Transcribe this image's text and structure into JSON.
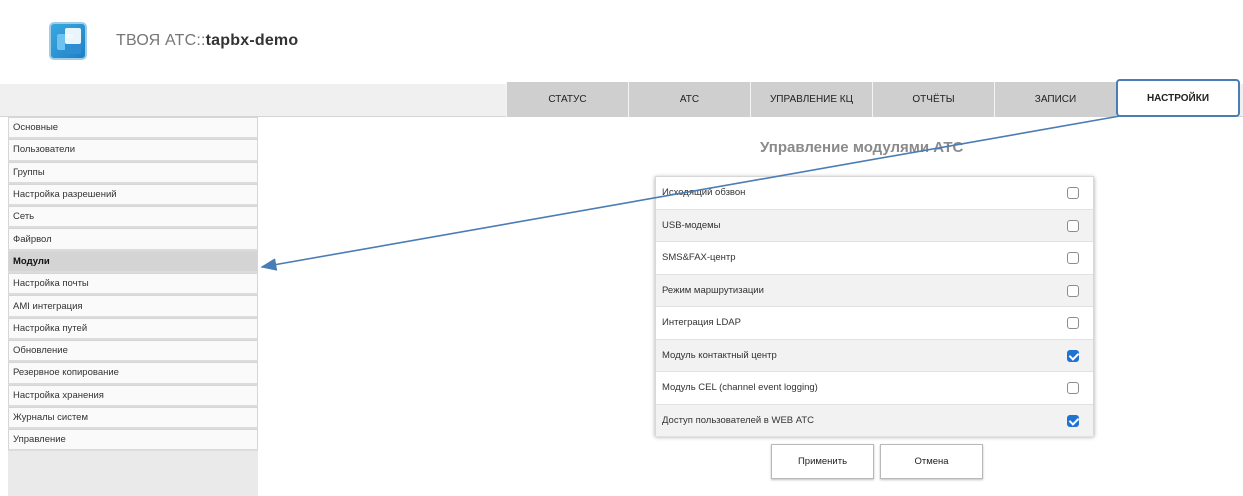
{
  "header": {
    "title_prefix": "ТВОЯ АТС::",
    "title_host": "tapbx-demo",
    "logo_icon": "app-logo-icon"
  },
  "tabs": [
    {
      "label": "СТАТУС"
    },
    {
      "label": "АТС"
    },
    {
      "label": "УПРАВЛЕНИЕ КЦ"
    },
    {
      "label": "ОТЧЁТЫ"
    },
    {
      "label": "ЗАПИСИ"
    },
    {
      "label": "НАСТРОЙКИ",
      "active": true
    }
  ],
  "sidebar": {
    "items": [
      {
        "label": "Основные"
      },
      {
        "label": "Пользователи"
      },
      {
        "label": "Группы"
      },
      {
        "label": "Настройка разрешений"
      },
      {
        "label": "Сеть"
      },
      {
        "label": "Файрвол"
      },
      {
        "label": "Модули",
        "active": true
      },
      {
        "label": "Настройка почты"
      },
      {
        "label": "AMI интеграция"
      },
      {
        "label": "Настройка путей"
      },
      {
        "label": "Обновление"
      },
      {
        "label": "Резервное копирование"
      },
      {
        "label": "Настройка хранения"
      },
      {
        "label": "Журналы систем"
      },
      {
        "label": "Управление"
      }
    ]
  },
  "main": {
    "title": "Управление модулями АТС",
    "modules": [
      {
        "label": "Исходящий обзвон",
        "checked": false
      },
      {
        "label": "USB-модемы",
        "checked": false
      },
      {
        "label": "SMS&FAX-центр",
        "checked": false
      },
      {
        "label": "Режим маршрутизации",
        "checked": false
      },
      {
        "label": "Интеграция LDAP",
        "checked": false
      },
      {
        "label": "Модуль контактный центр",
        "checked": true
      },
      {
        "label": "Модуль CEL (channel event logging)",
        "checked": false
      },
      {
        "label": "Доступ пользователей в WEB АТС",
        "checked": true
      }
    ],
    "apply_label": "Применить",
    "cancel_label": "Отмена"
  },
  "colors": {
    "accent": "#1f73d1",
    "arrow": "#4a7cb5",
    "tab_bg": "#cfcfcf",
    "active_tab_border": "#4a7cb5"
  }
}
